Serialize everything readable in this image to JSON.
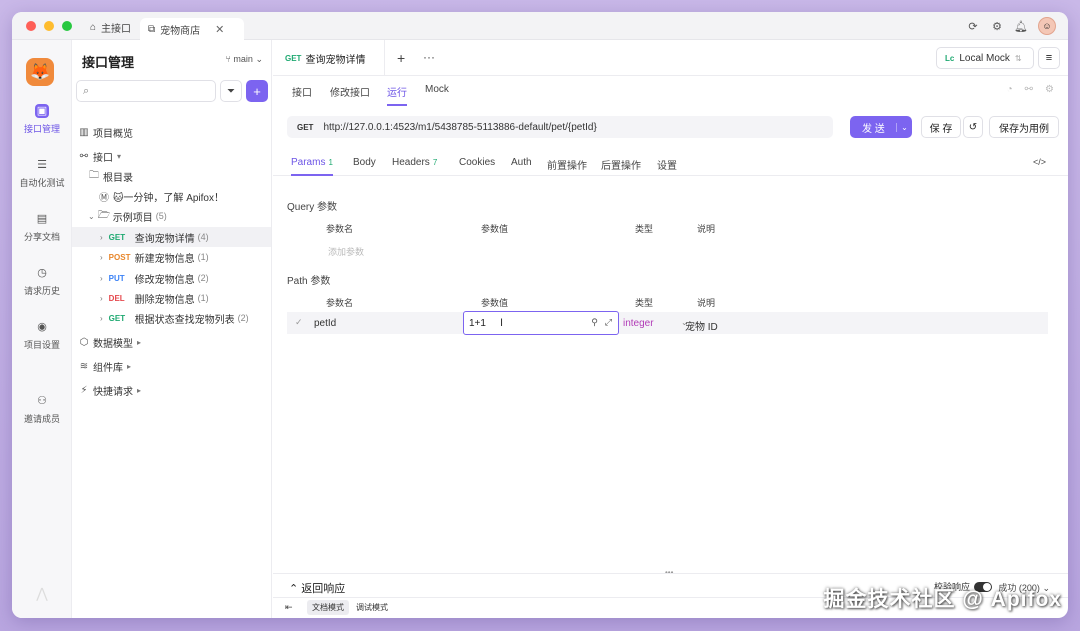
{
  "window_tabs": {
    "home": "主接口",
    "active": "宠物商店"
  },
  "rail": {
    "items": [
      {
        "label": "接口管理",
        "icon": "api-icon"
      },
      {
        "label": "自动化测试",
        "icon": "automation-icon"
      },
      {
        "label": "分享文档",
        "icon": "book-icon"
      },
      {
        "label": "请求历史",
        "icon": "clock-icon"
      },
      {
        "label": "项目设置",
        "icon": "settings-icon"
      },
      {
        "label": "邀请成员",
        "icon": "add-user-icon"
      }
    ]
  },
  "tree": {
    "title": "接口管理",
    "branch": "main",
    "overview": "项目概览",
    "api_root": "接口",
    "root_dir": "根目录",
    "intro_doc": "🐱一分钟，了解 Apifox！",
    "example_folder": "示例项目",
    "example_count": "(5)",
    "endpoints": [
      {
        "method": "GET",
        "name": "查询宠物详情",
        "count": "(4)"
      },
      {
        "method": "POST",
        "name": "新建宠物信息",
        "count": "(1)"
      },
      {
        "method": "PUT",
        "name": "修改宠物信息",
        "count": "(2)"
      },
      {
        "method": "DEL",
        "name": "删除宠物信息",
        "count": "(1)"
      },
      {
        "method": "GET",
        "name": "根据状态查找宠物列表",
        "count": "(2)"
      }
    ],
    "data_models": "数据模型",
    "components": "组件库",
    "quick_requests": "快捷请求"
  },
  "doc_tab": {
    "method": "GET",
    "name": "查询宠物详情"
  },
  "environment": {
    "badge": "Lc",
    "name": "Local Mock"
  },
  "sub_tabs": [
    "接口",
    "修改接口",
    "运行",
    "Mock"
  ],
  "url": {
    "method": "GET",
    "value": "http://127.0.0.1:4523/m1/5438785-5113886-default/pet/{petId}"
  },
  "buttons": {
    "send": "发 送",
    "save": "保 存",
    "save_case": "保存为用例"
  },
  "param_tabs": [
    {
      "label": "Params",
      "count": "1"
    },
    {
      "label": "Body",
      "count": ""
    },
    {
      "label": "Headers",
      "count": "7"
    },
    {
      "label": "Cookies",
      "count": ""
    },
    {
      "label": "Auth",
      "count": ""
    },
    {
      "label": "前置操作",
      "count": ""
    },
    {
      "label": "后置操作",
      "count": ""
    },
    {
      "label": "设置",
      "count": ""
    }
  ],
  "query": {
    "label": "Query 参数",
    "headers": [
      "参数名",
      "参数值",
      "类型",
      "说明"
    ],
    "add_placeholder": "添加参数"
  },
  "path": {
    "label": "Path 参数",
    "headers": [
      "参数名",
      "参数值",
      "类型",
      "说明"
    ],
    "row": {
      "name": "petId",
      "value": "1+1",
      "type": "integer",
      "desc": "宠物 ID"
    }
  },
  "response": {
    "title": "返回响应",
    "verify_label": "校验响应",
    "status": "成功 (200)"
  },
  "bottom": {
    "modes": [
      "文档模式",
      "调试模式"
    ]
  },
  "watermark": "掘金技术社区 @ Apifox"
}
